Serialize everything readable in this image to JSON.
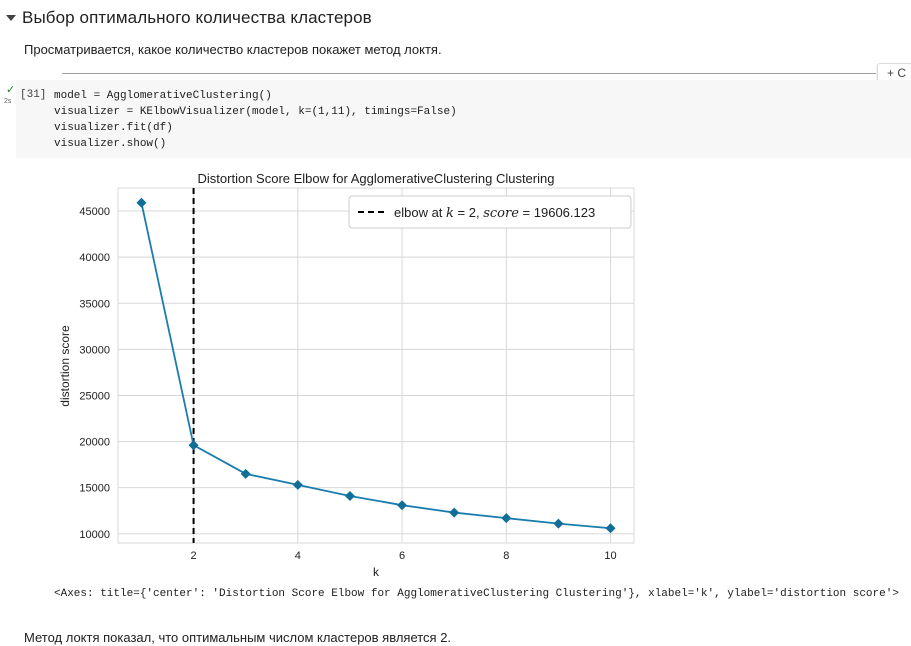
{
  "section": {
    "title": "Выбор оптимального количества кластеров",
    "intro": "Просматривается, какое количество кластеров покажет метод локтя."
  },
  "toolbar": {
    "add_code_label": "+ C"
  },
  "cell": {
    "exec_count": "[31]",
    "exec_time": "2s",
    "status_icon": "check-icon",
    "code_lines": [
      "model = AgglomerativeClustering()",
      "visualizer = KElbowVisualizer(model, k=(1,11), timings=False)",
      "visualizer.fit(df)",
      "visualizer.show()"
    ]
  },
  "output": {
    "axes_repr": "<Axes: title={'center': 'Distortion Score Elbow for AgglomerativeClustering Clustering'}, xlabel='k', ylabel='distortion score'>"
  },
  "conclusion": "Метод локтя показал, что оптимальным числом кластеров является 2.",
  "chart_data": {
    "type": "line",
    "title": "Distortion Score Elbow for AgglomerativeClustering Clustering",
    "xlabel": "k",
    "ylabel": "distortion score",
    "x": [
      1,
      2,
      3,
      4,
      5,
      6,
      7,
      8,
      9,
      10
    ],
    "values": [
      45900,
      19606.123,
      16500,
      15300,
      14100,
      13100,
      12300,
      11700,
      11100,
      10600
    ],
    "xlim": [
      0.55,
      10.45
    ],
    "ylim": [
      9000,
      47500
    ],
    "xticks": [
      2,
      4,
      6,
      8,
      10
    ],
    "yticks": [
      10000,
      15000,
      20000,
      25000,
      30000,
      35000,
      40000,
      45000
    ],
    "grid": true,
    "elbow": {
      "k": 2,
      "score": "19606.123"
    },
    "legend": {
      "position": "top-right"
    },
    "colors": {
      "line": "#1f77b4",
      "marker": "#106e99",
      "line_stroke": "#1a7db0",
      "elbow_line": "#000000",
      "grid": "#d8d8d8"
    }
  }
}
